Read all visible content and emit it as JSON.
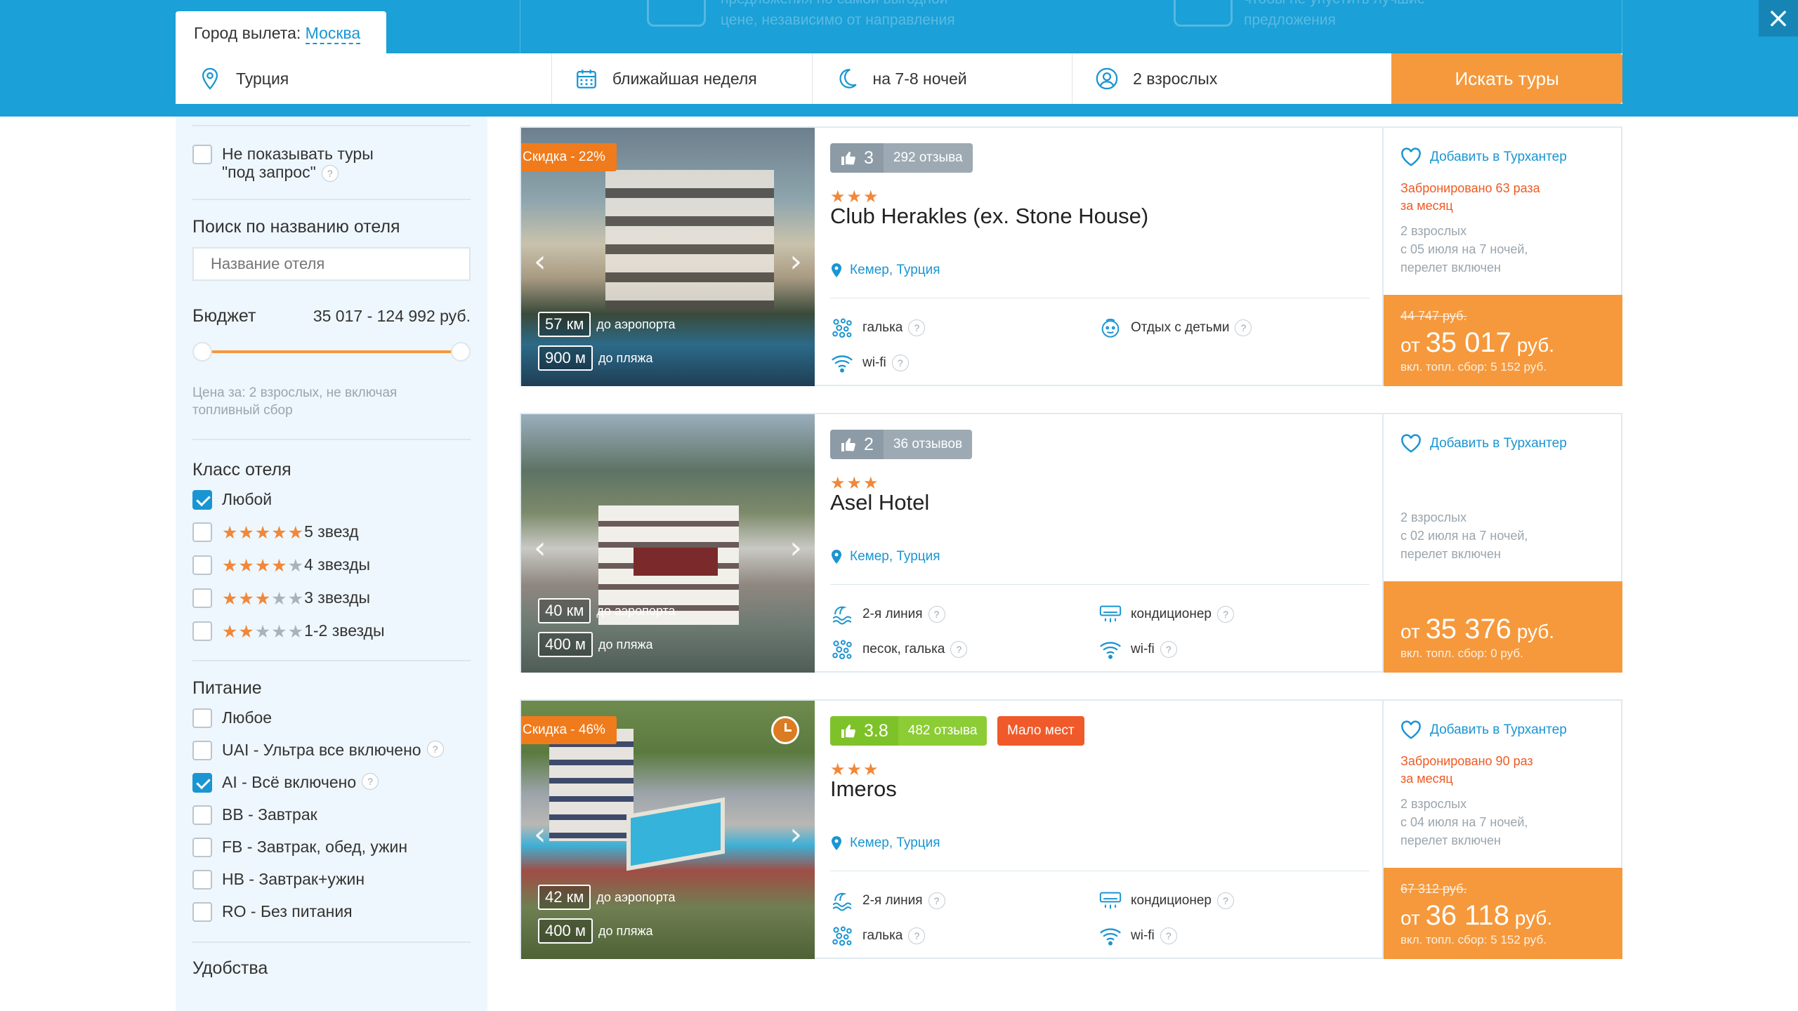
{
  "header": {
    "city_label": "Город вылета:",
    "city_value": "Москва",
    "promo": [
      "предложения по самой выгодной",
      "цене, независимо от направления",
      "чтобы не упустить лучшие",
      "предложения"
    ],
    "search": {
      "destination": "Турция",
      "dates": "ближайшая неделя",
      "nights": "на 7-8 ночей",
      "travelers": "2 взрослых",
      "button": "Искать туры"
    },
    "close": "×"
  },
  "sidebar": {
    "no_request_line1": "Не показывать туры",
    "no_request_line2": "\"под запрос\"",
    "hotel_search_title": "Поиск по названию отеля",
    "hotel_search_placeholder": "Название отеля",
    "budget_title": "Бюджет",
    "budget_value": "35 017 - 124 992 руб.",
    "budget_range_fraction": [
      0.0,
      1.0
    ],
    "price_note_line1": "Цена за: 2 взрослых, не включая",
    "price_note_line2": "топливный сбор",
    "class_title": "Класс отеля",
    "class_options": [
      {
        "label": "Любой",
        "checked": true,
        "stars": 0
      },
      {
        "label": "5 звезд",
        "checked": false,
        "stars": 5
      },
      {
        "label": "4 звезды",
        "checked": false,
        "stars": 4
      },
      {
        "label": "3 звезды",
        "checked": false,
        "stars": 3
      },
      {
        "label": "1-2 звезды",
        "checked": false,
        "stars": 2
      }
    ],
    "meal_title": "Питание",
    "meal_options": [
      {
        "label": "Любое",
        "checked": false,
        "help": false
      },
      {
        "label": "UAI - Ультра все включено",
        "checked": false,
        "help": true
      },
      {
        "label": "AI - Всё включено",
        "checked": true,
        "help": true
      },
      {
        "label": "BB - Завтрак",
        "checked": false,
        "help": false
      },
      {
        "label": "FB - Завтрак, обед, ужин",
        "checked": false,
        "help": false
      },
      {
        "label": "HB - Завтрак+ужин",
        "checked": false,
        "help": false
      },
      {
        "label": "RO - Без питания",
        "checked": false,
        "help": false
      }
    ],
    "amenities_title": "Удобства"
  },
  "common": {
    "fav_label": "Добавить в Турхантер",
    "to_airport": "до аэропорта",
    "to_beach": "до пляжа",
    "help": "?",
    "prev": "‹",
    "next": "›"
  },
  "hotels": [
    {
      "discount": "Скидка - 22%",
      "rating": "3",
      "reviews": "292 отзыва",
      "rating_color": "gray",
      "few_places": "",
      "stars": "★★★",
      "name": "Club Herakles (ex. Stone House)",
      "location": "Кемер, Турция",
      "airport_km": "57 км",
      "beach_m": "900 м",
      "amenities": [
        {
          "icon": "pebble-icon",
          "label": "галька"
        },
        {
          "icon": "kids-icon",
          "label": "Отдых с детьми"
        },
        {
          "icon": "wifi-icon",
          "label": "wi-fi"
        }
      ],
      "booked_line1": "Забронировано 63 раза",
      "booked_line2": "за месяц",
      "tour_line1": "2 взрослых",
      "tour_line2": "с 05 июля на 7 ночей,",
      "tour_line3": "перелет включен",
      "old_price": "44 747 руб.",
      "price_prefix": "от",
      "price": "35 017",
      "price_suffix": "руб.",
      "fee": "вкл. топл. сбор: 5 152 руб."
    },
    {
      "discount": "",
      "rating": "2",
      "reviews": "36 отзывов",
      "rating_color": "gray",
      "few_places": "",
      "stars": "★★★",
      "name": "Asel Hotel",
      "location": "Кемер, Турция",
      "airport_km": "40 км",
      "beach_m": "400 м",
      "amenities": [
        {
          "icon": "beach-line-icon",
          "label": "2-я линия"
        },
        {
          "icon": "air-conditioner-icon",
          "label": "кондиционер"
        },
        {
          "icon": "pebble-icon",
          "label": "песок, галька"
        },
        {
          "icon": "wifi-icon",
          "label": "wi-fi"
        }
      ],
      "booked_line1": "",
      "booked_line2": "",
      "tour_line1": "2 взрослых",
      "tour_line2": "с 02 июля на 7 ночей,",
      "tour_line3": "перелет включен",
      "old_price": "",
      "price_prefix": "от",
      "price": "35 376",
      "price_suffix": "руб.",
      "fee": "вкл. топл. сбор: 0 руб."
    },
    {
      "discount": "Скидка - 46%",
      "rating": "3.8",
      "reviews": "482 отзыва",
      "rating_color": "green",
      "few_places": "Мало мест",
      "stars": "★★★",
      "name": "Imeros",
      "location": "Кемер, Турция",
      "airport_km": "42 км",
      "beach_m": "400 м",
      "amenities": [
        {
          "icon": "beach-line-icon",
          "label": "2-я линия"
        },
        {
          "icon": "air-conditioner-icon",
          "label": "кондиционер"
        },
        {
          "icon": "pebble-icon",
          "label": "галька"
        },
        {
          "icon": "wifi-icon",
          "label": "wi-fi"
        }
      ],
      "booked_line1": "Забронировано 90 раз",
      "booked_line2": "за месяц",
      "tour_line1": "2 взрослых",
      "tour_line2": "с 04 июля на 7 ночей,",
      "tour_line3": "перелет включен",
      "old_price": "67 312 руб.",
      "price_prefix": "от",
      "price": "36 118",
      "price_suffix": "руб.",
      "fee": "вкл. топл. сбор: 5 152 руб."
    }
  ],
  "colors": {
    "brand_blue": "#1ba0d7",
    "accent_orange": "#f5993c",
    "discount_orange": "#f07b1c",
    "alert_red": "#ef5a23",
    "rating_green": "#7ec229"
  }
}
